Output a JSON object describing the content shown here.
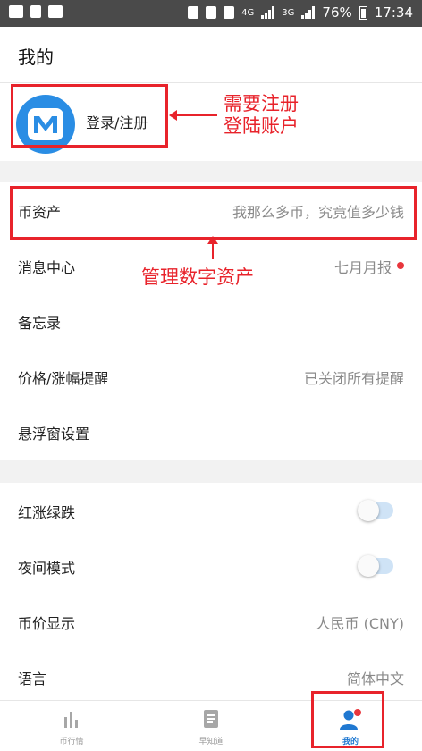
{
  "status_bar": {
    "battery": "76%",
    "time": "17:34",
    "network_a": "4G",
    "network_b": "3G"
  },
  "header": {
    "title": "我的"
  },
  "login": {
    "label": "登录/注册",
    "avatar_letter_icon": "m-logo-icon"
  },
  "annotations": {
    "login_note_line1": "需要注册",
    "login_note_line2": "登陆账户",
    "assets_note": "管理数字资产"
  },
  "rows": [
    {
      "label": "币资产",
      "value": "我那么多币，究竟值多少钱"
    },
    {
      "label": "消息中心",
      "value": "七月月报",
      "dot": true
    },
    {
      "label": "备忘录",
      "value": ""
    },
    {
      "label": "价格/涨幅提醒",
      "value": "已关闭所有提醒"
    },
    {
      "label": "悬浮窗设置",
      "value": ""
    }
  ],
  "settings": [
    {
      "label": "红涨绿跌",
      "toggle": false
    },
    {
      "label": "夜间模式",
      "toggle": false
    },
    {
      "label": "币价显示",
      "value": "人民币 (CNY)"
    },
    {
      "label": "语言",
      "value": "简体中文"
    }
  ],
  "tabs": [
    {
      "label": "币行情",
      "icon": "bar-chart-icon"
    },
    {
      "label": "早知道",
      "icon": "document-icon"
    },
    {
      "label": "我的",
      "icon": "user-icon",
      "active": true
    }
  ],
  "colors": {
    "accent": "#1f78d1",
    "annotation": "#e8232b",
    "avatar": "#2a8de4"
  }
}
